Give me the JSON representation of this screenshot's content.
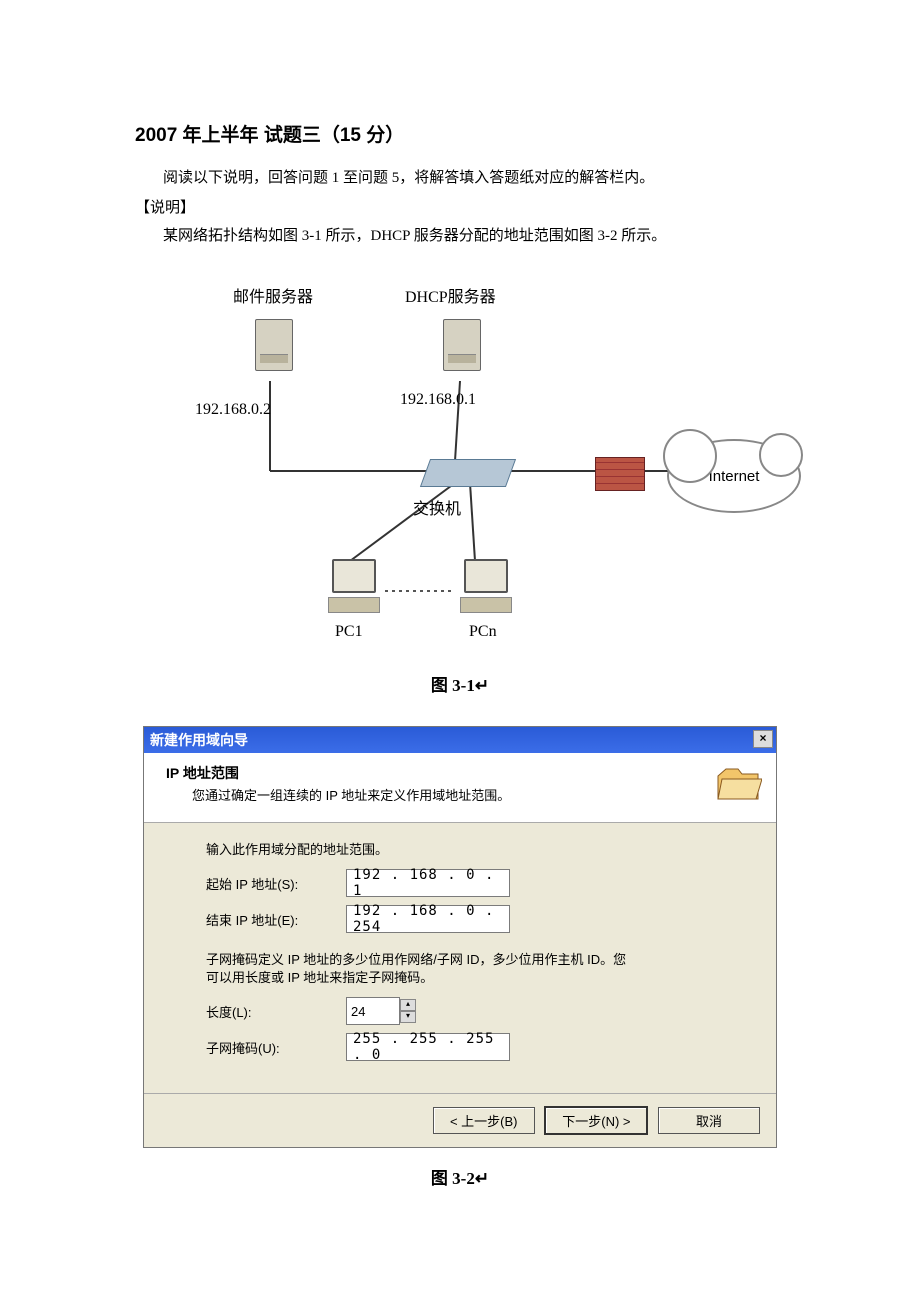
{
  "document": {
    "title": "2007 年上半年  试题三（15 分）",
    "instruction": "阅读以下说明，回答问题 1 至问题 5，将解答填入答题纸对应的解答栏内。",
    "explain_heading": "【说明】",
    "explain_body": "某网络拓扑结构如图 3-1 所示，DHCP 服务器分配的地址范围如图 3-2 所示。"
  },
  "diagram": {
    "labels": {
      "mail_server": "邮件服务器",
      "dhcp_server": "DHCP服务器",
      "mail_ip": "192.168.0.2",
      "dhcp_ip": "192.168.0.1",
      "switch": "交换机",
      "pc1": "PC1",
      "pcn": "PCn",
      "internet": "Internet"
    },
    "caption": "图 3-1↵"
  },
  "dialog": {
    "title": "新建作用域向导",
    "close": "×",
    "header_title": "IP 地址范围",
    "header_sub": "您通过确定一组连续的 IP 地址来定义作用域地址范围。",
    "body_line1": "输入此作用域分配的地址范围。",
    "start_ip_label": "起始 IP 地址(S):",
    "start_ip_value": "192 . 168 .  0  .  1",
    "end_ip_label": "结束 IP 地址(E):",
    "end_ip_value": "192 . 168 .  0  . 254",
    "subnet_desc1": "子网掩码定义 IP 地址的多少位用作网络/子网 ID，多少位用作主机 ID。您",
    "subnet_desc2": "可以用长度或 IP 地址来指定子网掩码。",
    "len_label": "长度(L):",
    "len_value": "24",
    "mask_label": "子网掩码(U):",
    "mask_value": "255 . 255 . 255 .  0",
    "btn_back": "< 上一步(B)",
    "btn_next": "下一步(N) >",
    "btn_cancel": "取消"
  },
  "caption2": "图 3-2↵"
}
